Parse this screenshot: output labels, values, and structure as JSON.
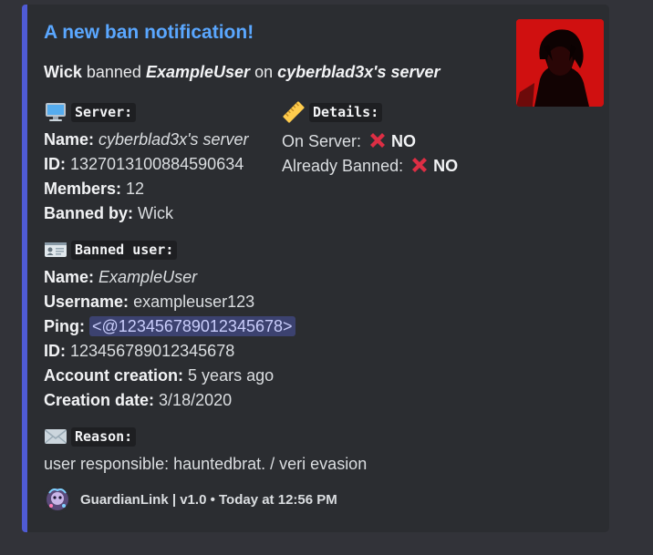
{
  "embed": {
    "accent_color": "#4f5bd5",
    "title": "A new ban notification!",
    "summary": {
      "actor": "Wick",
      "verb": "banned",
      "target": "ExampleUser",
      "preposition": "on",
      "server": "cyberblad3x's server"
    },
    "server_section": {
      "icon": "computer-icon",
      "label": "Server:",
      "name_key": "Name:",
      "name_value": "cyberblad3x's server",
      "id_key": "ID:",
      "id_value": "1327013100884590634",
      "members_key": "Members:",
      "members_value": "12",
      "bannedby_key": "Banned by:",
      "bannedby_value": "Wick"
    },
    "details_section": {
      "icon": "ruler-icon",
      "label": "Details:",
      "onserver_key": "On Server:",
      "onserver_value": "NO",
      "alreadybanned_key": "Already Banned:",
      "alreadybanned_value": "NO"
    },
    "user_section": {
      "icon": "id-card-icon",
      "label": "Banned user:",
      "name_key": "Name:",
      "name_value": "ExampleUser",
      "username_key": "Username:",
      "username_value": "exampleuser123",
      "ping_key": "Ping:",
      "ping_value": "<@123456789012345678>",
      "id_key": "ID:",
      "id_value": "123456789012345678",
      "creation_key": "Account creation:",
      "creation_value": "5 years ago",
      "date_key": "Creation date:",
      "date_value": "3/18/2020"
    },
    "reason_section": {
      "icon": "envelope-icon",
      "label": "Reason:",
      "text": "user responsible: hauntedbrat. / veri evasion"
    },
    "footer": {
      "text": "GuardianLink | v1.0 • Today at 12:56 PM"
    }
  }
}
